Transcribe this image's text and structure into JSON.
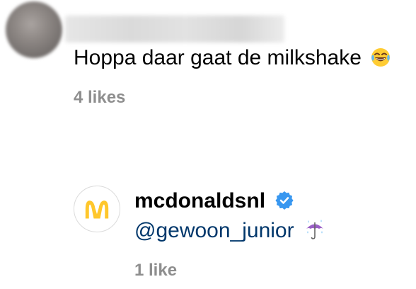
{
  "colors": {
    "text": "#000000",
    "muted": "#8e8e8e",
    "mention": "#00376b",
    "verified": "#3897f0",
    "mcd_yellow": "#ffc72c"
  },
  "comment": {
    "text": "Hoppa daar gaat de milkshake",
    "emoji": "face-with-tears-of-joy",
    "likes": "4 likes"
  },
  "reply": {
    "username": "mcdonaldsnl",
    "verified_icon": "verified-badge-icon",
    "mention": "@gewoon_junior",
    "emoji": "umbrella-with-rain-drops",
    "likes": "1 like"
  }
}
